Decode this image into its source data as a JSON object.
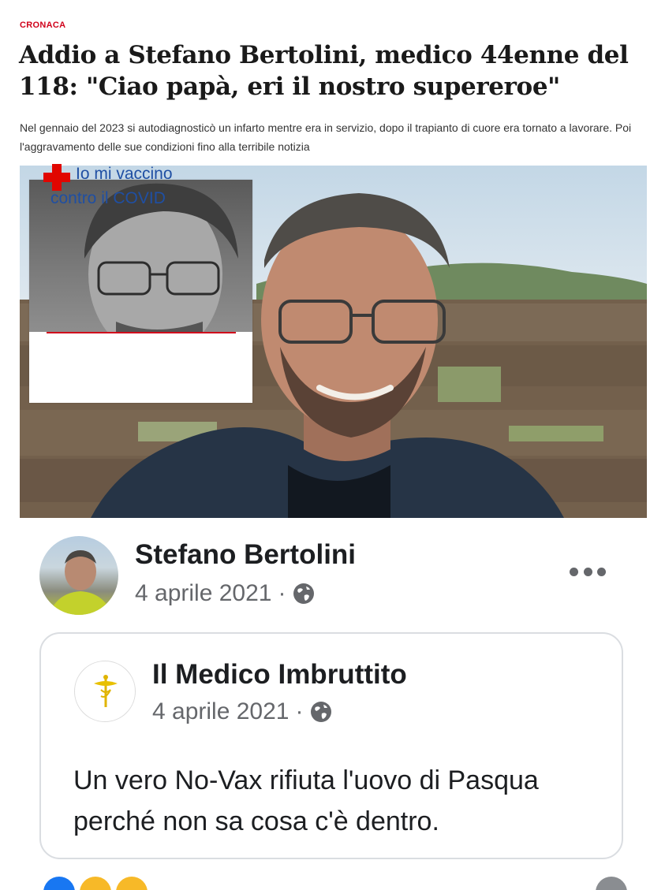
{
  "article": {
    "category": "CRONACA",
    "headline": "Addio a Stefano Bertolini, medico 44enne del 118: \"Ciao papà, eri il nostro supereroe\"",
    "subheadline": "Nel gennaio del 2023 si autodiagnosticò un infarto mentre era in servizio, dopo il trapianto di cuore era tornato a lavorare. Poi l'aggravamento delle sue condizioni fino alla terribile notizia",
    "hero_badge": {
      "line1": "Io mi vaccino",
      "line2": "contro il COVID",
      "icon": "red-cross-icon"
    }
  },
  "post": {
    "author": "Stefano Bertolini",
    "date": "4 aprile 2021",
    "separator": "·",
    "audience_icon": "globe-icon",
    "more_icon": "more-options-icon",
    "shared": {
      "page_name": "Il Medico Imbruttito",
      "date": "4 aprile 2021",
      "separator": "·",
      "text": "Un vero No-Vax rifiuta l'uovo di Pasqua perché non sa cosa c'è dentro."
    }
  },
  "colors": {
    "category": "#d0021b",
    "badge_text": "#1f4fa3",
    "cross": "#e10600",
    "fb_meta": "#65676b"
  }
}
